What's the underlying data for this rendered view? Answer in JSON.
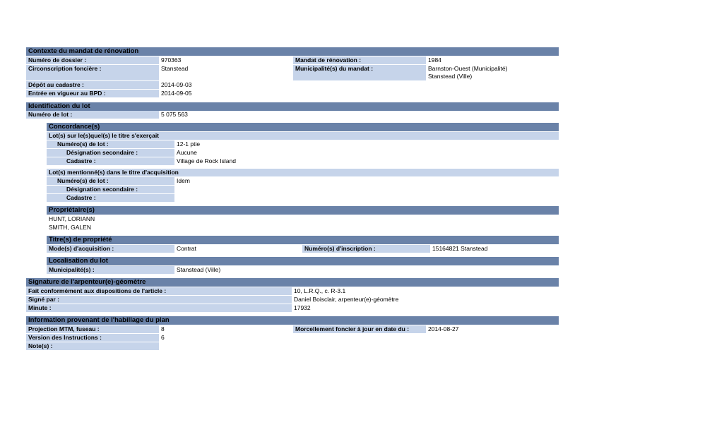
{
  "contexte": {
    "title": "Contexte du mandat de rénovation",
    "numero_dossier_label": "Numéro de dossier :",
    "numero_dossier": "970363",
    "circonscription_label": "Circonscription foncière :",
    "circonscription": "Stanstead",
    "depot_label": "Dépôt au cadastre :",
    "depot": "2014-09-03",
    "entree_label": "Entrée en vigueur au BPD :",
    "entree": "2014-09-05",
    "mandat_label": "Mandat de rénovation :",
    "mandat": "1984",
    "municipalites_label": "Municipalité(s) du mandat :",
    "municipalite_1": "Barnston-Ouest (Municipalité)",
    "municipalite_2": "Stanstead (Ville)"
  },
  "identification": {
    "title": "Identification du lot",
    "numero_lot_label": "Numéro de lot :",
    "numero_lot": "5 075 563"
  },
  "concordance": {
    "title": "Concordance(s)",
    "titre_exercait_label": "Lot(s) sur le(s)quel(s) le titre s'exerçait",
    "lot1": {
      "numero_label": "Numéro(s) de lot :",
      "numero": "12-1 ptie",
      "designation_label": "Désignation secondaire :",
      "designation": "Aucune",
      "cadastre_label": "Cadastre :",
      "cadastre": "Village de Rock Island"
    },
    "titre_acquisition_label": "Lot(s) mentionné(s) dans le titre d'acquisition",
    "lot2": {
      "numero_label": "Numéro(s) de lot :",
      "numero": "Idem",
      "designation_label": "Désignation secondaire :",
      "cadastre_label": "Cadastre :"
    }
  },
  "proprietaires": {
    "title": "Propriétaire(s)",
    "names": [
      "HUNT, LORIANN",
      "SMITH, GALEN"
    ]
  },
  "titre": {
    "title": "Titre(s) de propriété",
    "mode_label": "Mode(s) d'acquisition :",
    "mode": "Contrat",
    "inscription_label": "Numéro(s) d'inscription :",
    "inscription": "15164821 Stanstead"
  },
  "localisation": {
    "title": "Localisation du lot",
    "municipalite_label": "Municipalité(s) :",
    "municipalite": "Stanstead (Ville)"
  },
  "signature": {
    "title": "Signature de l'arpenteur(e)-géomètre",
    "article_label": "Fait conformément aux dispositions de l'article :",
    "article": "10, L.R.Q., c. R-3.1",
    "signe_label": "Signé par :",
    "signe": "Daniel Boisclair, arpenteur(e)-géomètre",
    "minute_label": "Minute :",
    "minute": "17932"
  },
  "habillage": {
    "title": "Information provenant de l'habillage du plan",
    "projection_label": "Projection MTM, fuseau :",
    "projection": "8",
    "version_label": "Version des Instructions :",
    "version": "6",
    "notes_label": "Note(s) :",
    "morcellement_label": "Morcellement foncier à jour en date du :",
    "morcellement": "2014-08-27"
  },
  "colors": {
    "section_header": "#6a82a8",
    "label_bg": "#c6d4ea"
  }
}
